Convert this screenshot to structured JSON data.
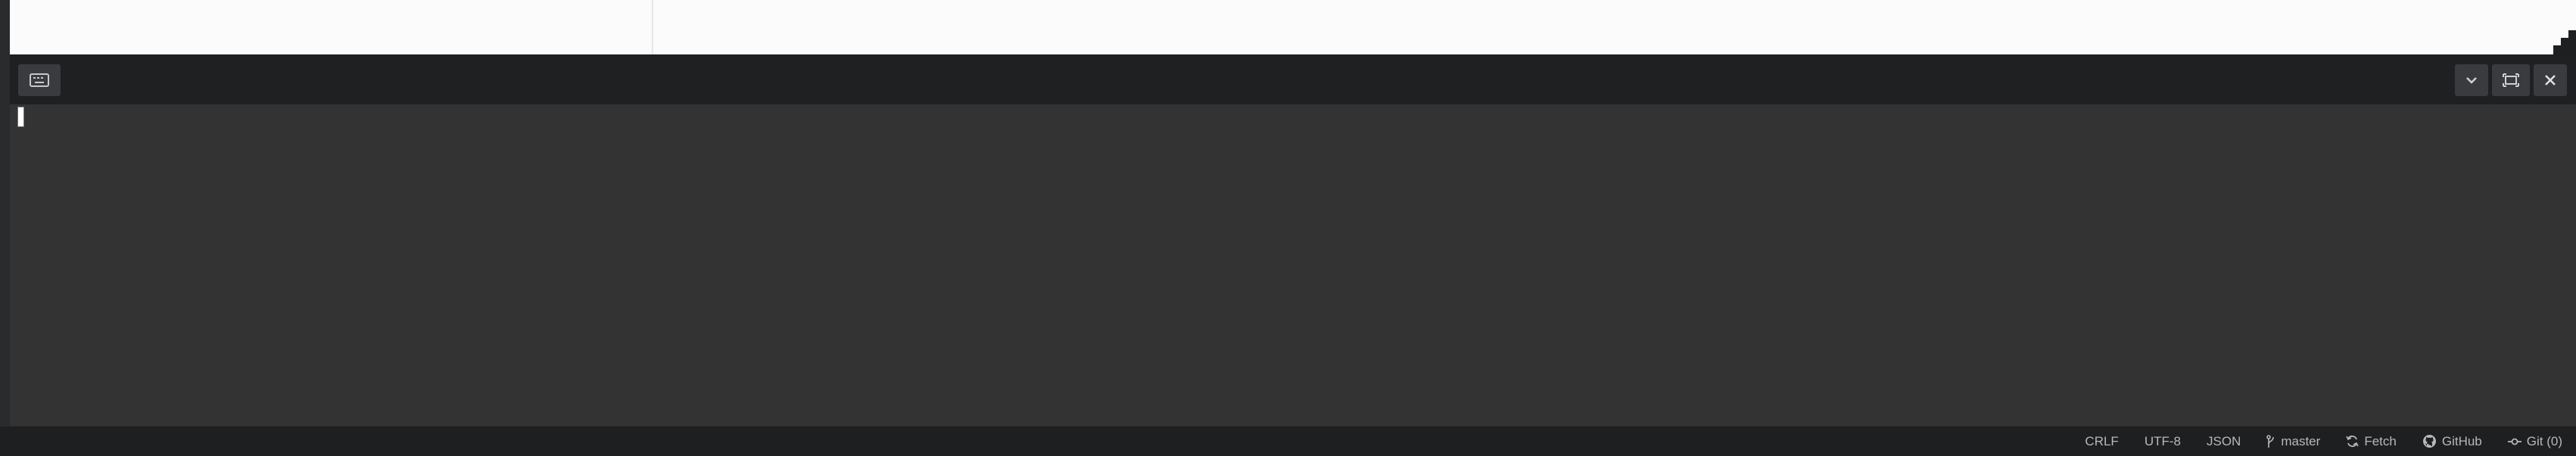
{
  "status_bar": {
    "line_ending": "CRLF",
    "encoding": "UTF-8",
    "language": "JSON",
    "branch": "master",
    "fetch": "Fetch",
    "github": "GitHub",
    "git": "Git (0)"
  },
  "icons": {
    "terminal_toggle": "keyboard-icon",
    "collapse": "chevron-down-icon",
    "maximize": "maximize-icon",
    "close": "close-icon",
    "branch": "git-branch-icon",
    "fetch": "refresh-icon",
    "github": "github-icon",
    "git": "git-commit-icon"
  },
  "colors": {
    "editor_bg": "#fbfbfb",
    "panel_header_bg": "#1f2022",
    "terminal_bg": "#333333",
    "status_bar_bg": "#1e1f21",
    "status_text": "#b8b8b8"
  }
}
